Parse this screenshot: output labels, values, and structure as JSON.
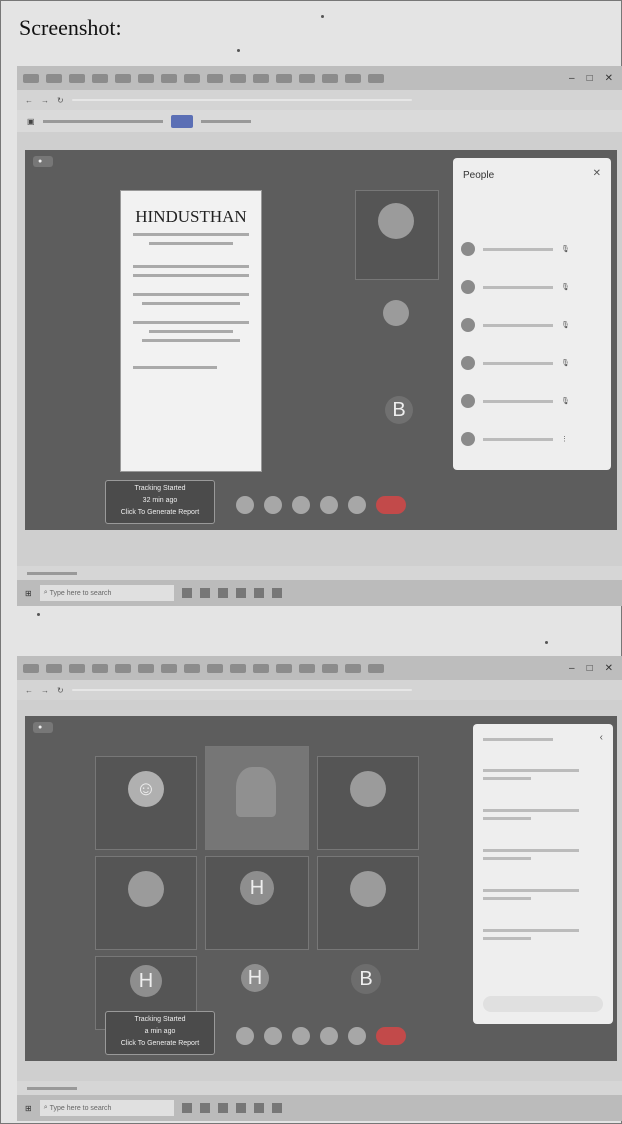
{
  "page": {
    "heading": "Screenshot:"
  },
  "shot1": {
    "tracking": {
      "line1": "Tracking Started",
      "line2": "32 min ago",
      "line3": "Click To Generate Report"
    },
    "slide": {
      "title": "HINDUSTHAN"
    },
    "people_panel": {
      "title": "People"
    },
    "tile_tag": "B"
  },
  "shot2": {
    "tracking": {
      "line1": "Tracking Started",
      "line2": "a min ago",
      "line3": "Click To Generate Report"
    },
    "tiles": [
      {
        "letter": "☺"
      },
      {
        "letter": "H"
      },
      {
        "letter": "H"
      },
      {
        "letter": "H"
      },
      {
        "letter": "B"
      }
    ]
  },
  "taskbar": {
    "search_placeholder": "Type here to search"
  },
  "icons": {
    "close": "close-icon",
    "mic": "mic-icon",
    "camera": "camera-icon",
    "present": "present-icon",
    "end_call": "end-call-icon",
    "search": "search-icon"
  }
}
